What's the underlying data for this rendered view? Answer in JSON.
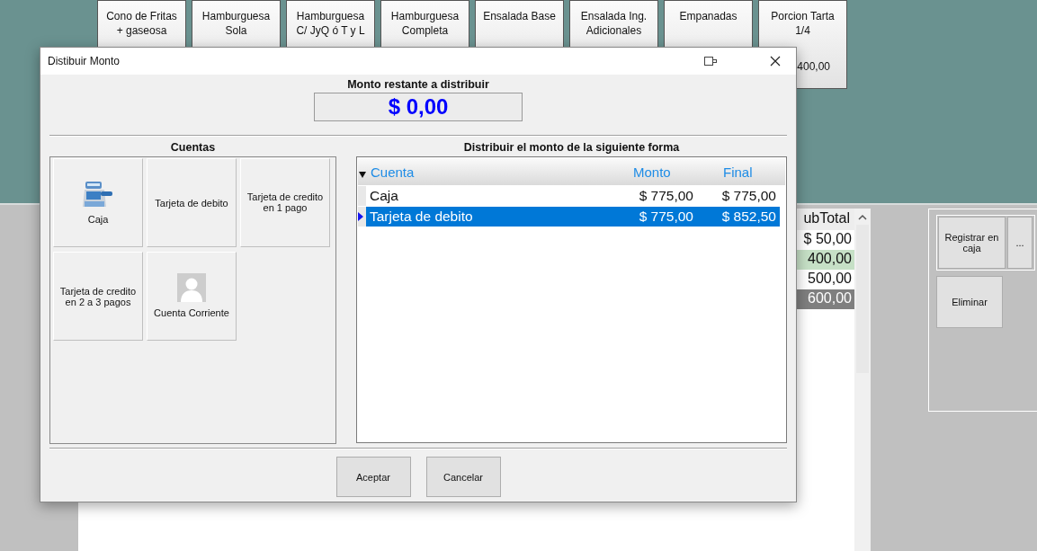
{
  "products": [
    {
      "lines": [
        "Cono de Fritas",
        "+ gaseosa"
      ]
    },
    {
      "lines": [
        "Hamburguesa",
        "Sola"
      ]
    },
    {
      "lines": [
        "Hamburguesa",
        "C/ JyQ ó T y L"
      ]
    },
    {
      "lines": [
        "Hamburguesa",
        "Completa"
      ]
    },
    {
      "lines": [
        "Ensalada Base"
      ]
    },
    {
      "lines": [
        "Ensalada Ing.",
        "Adicionales"
      ]
    },
    {
      "lines": [
        "Empanadas"
      ]
    },
    {
      "lines": [
        "Porcion Tarta",
        "1/4"
      ],
      "price": "400,00"
    }
  ],
  "subtotal_table": {
    "header": "ubTotal",
    "rows": [
      {
        "value": "$ 50,00",
        "color": "#ffffff"
      },
      {
        "value": "400,00",
        "color": "#c6e0c6"
      },
      {
        "value": "500,00",
        "color": "#ffffff"
      },
      {
        "value": "600,00",
        "color": "#7f7f7f"
      }
    ]
  },
  "side_buttons": [
    {
      "label": "Registrar en caja"
    },
    {
      "label": "..."
    },
    {
      "label": "Eliminar"
    }
  ],
  "dialog": {
    "title": "Distibuir Monto",
    "remaining_label": "Monto restante a distribuir",
    "remaining_value": "$ 0,00",
    "accounts_title": "Cuentas",
    "accounts": [
      {
        "label": "Caja",
        "kind": "register"
      },
      {
        "label": "Tarjeta de debito",
        "kind": "text"
      },
      {
        "label": "Tarjeta de credito en 1 pago",
        "kind": "text"
      },
      {
        "label": "Tarjeta de credito en 2 a 3 pagos",
        "kind": "text"
      },
      {
        "label": "Cuenta Corriente",
        "kind": "person"
      }
    ],
    "distribution_title": "Distribuir el monto de la siguiente forma",
    "columns": [
      "Cuenta",
      "Monto",
      "Final"
    ],
    "rows": [
      {
        "cuenta": "Caja",
        "monto": "$ 775,00",
        "final": "$ 775,00",
        "selected": false
      },
      {
        "cuenta": "Tarjeta de debito",
        "monto": "$ 775,00",
        "final": "$ 852,50",
        "selected": true
      }
    ],
    "buttons": [
      "Aceptar",
      "Cancelar"
    ]
  }
}
